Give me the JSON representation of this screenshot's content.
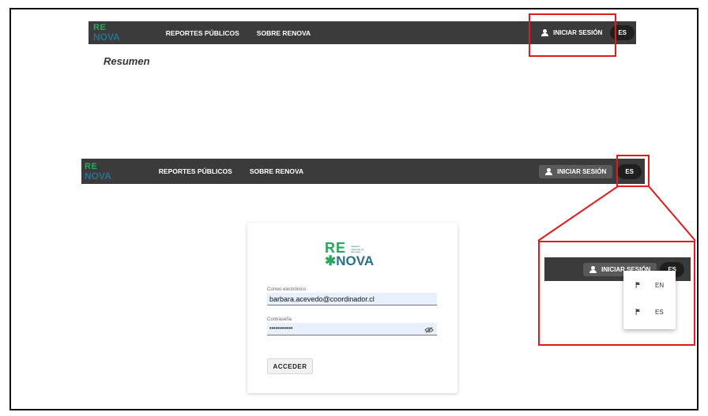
{
  "app": {
    "logo_top": "RE",
    "logo_bottom": "NOVA",
    "logo_tagline": "Registro Nacional de Energías",
    "brand_green": "#2aa65f",
    "brand_blue": "#2b6f8f",
    "navbar_color": "#3b3b3b"
  },
  "nav": {
    "reportes": "REPORTES PÚBLICOS",
    "sobre": "SOBRE RENOVA",
    "login": "INICIAR SESIÓN",
    "lang": "ES"
  },
  "page": {
    "resumen": "Resumen"
  },
  "login_form": {
    "email_label": "Correo electrónico",
    "email_value": "barbara.acevedo@coordinador.cl",
    "password_label": "Contraseña",
    "password_value": "••••••••••••",
    "submit": "ACCEDER"
  },
  "language_menu": {
    "items": [
      {
        "code": "EN",
        "icon": "flag-icon"
      },
      {
        "code": "ES",
        "icon": "flag-icon"
      }
    ]
  },
  "annotation_color": "#e01b1b"
}
